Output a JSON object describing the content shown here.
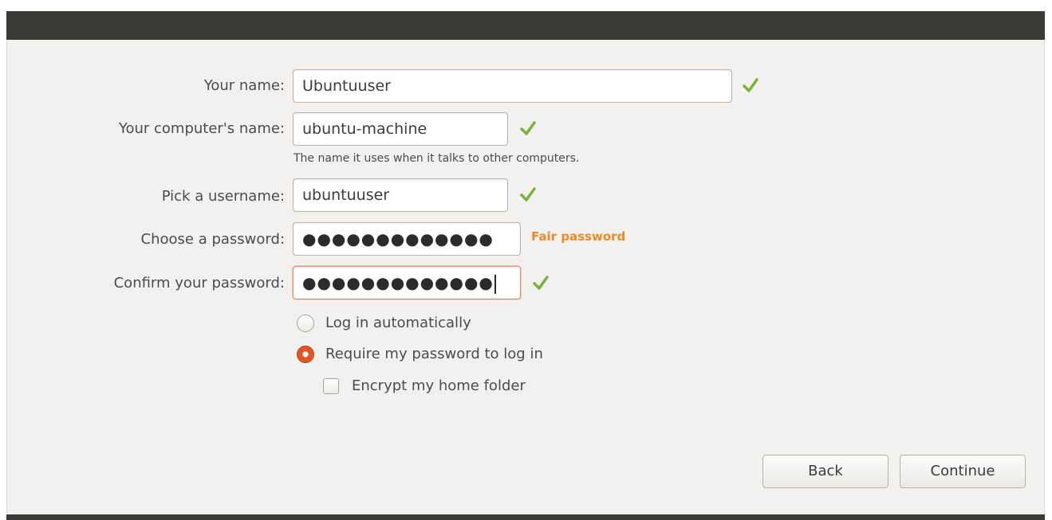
{
  "form": {
    "name_label": "Your name:",
    "name_value": "Ubuntuuser",
    "computer_label": "Your computer's name:",
    "computer_value": "ubuntu-machine",
    "computer_hint": "The name it uses when it talks to other computers.",
    "username_label": "Pick a username:",
    "username_value": "ubuntuuser",
    "password_label": "Choose a password:",
    "password_value": "●●●●●●●●●●●●●",
    "password_strength": "Fair password",
    "confirm_label": "Confirm your password:",
    "confirm_value": "●●●●●●●●●●●●●"
  },
  "options": {
    "login_auto": "Log in automatically",
    "login_auto_selected": false,
    "require_password": "Require my password to log in",
    "require_password_selected": true,
    "encrypt_home": "Encrypt my home folder",
    "encrypt_home_checked": false
  },
  "buttons": {
    "back": "Back",
    "continue": "Continue"
  },
  "colors": {
    "accent": "#e0562a",
    "valid_check": "#7ab33c",
    "strength_fair": "#f08a24",
    "titlebar": "#3c3b37"
  },
  "icons": {
    "valid": "check-mark-icon"
  }
}
